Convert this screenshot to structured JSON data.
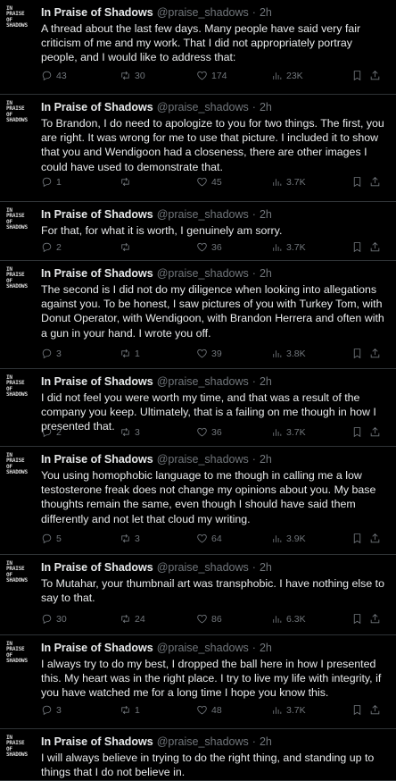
{
  "author": {
    "name": "In Praise of Shadows",
    "handle": "@praise_shadows",
    "avatar_text": "IN\nPRAISE\nOF\nSHADOWS"
  },
  "separator": "·",
  "tweets": [
    {
      "time": "2h",
      "text": "A thread about the last few days. Many people have said very fair criticism of me and my work. That I did not appropriately portray people, and I would like to address that:",
      "replies": "43",
      "retweets": "30",
      "likes": "174",
      "views": "23K"
    },
    {
      "time": "2h",
      "text": "To Brandon, I do need to apologize to you for two things. The first, you are right. It was wrong for me to use that picture. I included it to show that you and Wendigoon had a closeness, there are other images I could have used to demonstrate that.",
      "replies": "1",
      "retweets": "",
      "likes": "45",
      "views": "3.7K"
    },
    {
      "time": "2h",
      "text": "For that, for what it is worth, I genuinely am sorry.",
      "replies": "2",
      "retweets": "",
      "likes": "36",
      "views": "3.7K"
    },
    {
      "time": "2h",
      "text": "The second is I did not do my diligence when looking into allegations against you. To be honest, I saw pictures of you with Turkey Tom, with Donut Operator, with Wendigoon, with Brandon Herrera and often with a gun in your hand. I wrote you off.",
      "replies": "3",
      "retweets": "1",
      "likes": "39",
      "views": "3.8K"
    },
    {
      "time": "2h",
      "text": "I did not feel you were worth my time, and that was a result of the company you keep. Ultimately, that is a failing on me though in how I presented that.",
      "replies": "2",
      "retweets": "3",
      "likes": "36",
      "views": "3.7K"
    },
    {
      "time": "2h",
      "text": "You using homophobic language to me though in calling me a low testosterone freak does not change my opinions about you. My base thoughts remain the same, even though I should have said them differently and not let that cloud my writing.",
      "replies": "5",
      "retweets": "3",
      "likes": "64",
      "views": "3.9K"
    },
    {
      "time": "2h",
      "text": "To Mutahar, your thumbnail art was transphobic. I have nothing else to say to that.",
      "replies": "30",
      "retweets": "24",
      "likes": "86",
      "views": "6.3K"
    },
    {
      "time": "2h",
      "text": "I always try to do my best, I dropped the ball here in how I presented this. My heart was in the right place. I try to live my life with integrity, if you have watched me for a long time I hope you know this.",
      "replies": "3",
      "retweets": "1",
      "likes": "48",
      "views": "3.7K"
    },
    {
      "time": "2h",
      "text": "I will always believe in trying to do the right thing, and standing up to things that I do not believe in.",
      "replies": "",
      "retweets": "",
      "likes": "",
      "views": ""
    }
  ]
}
